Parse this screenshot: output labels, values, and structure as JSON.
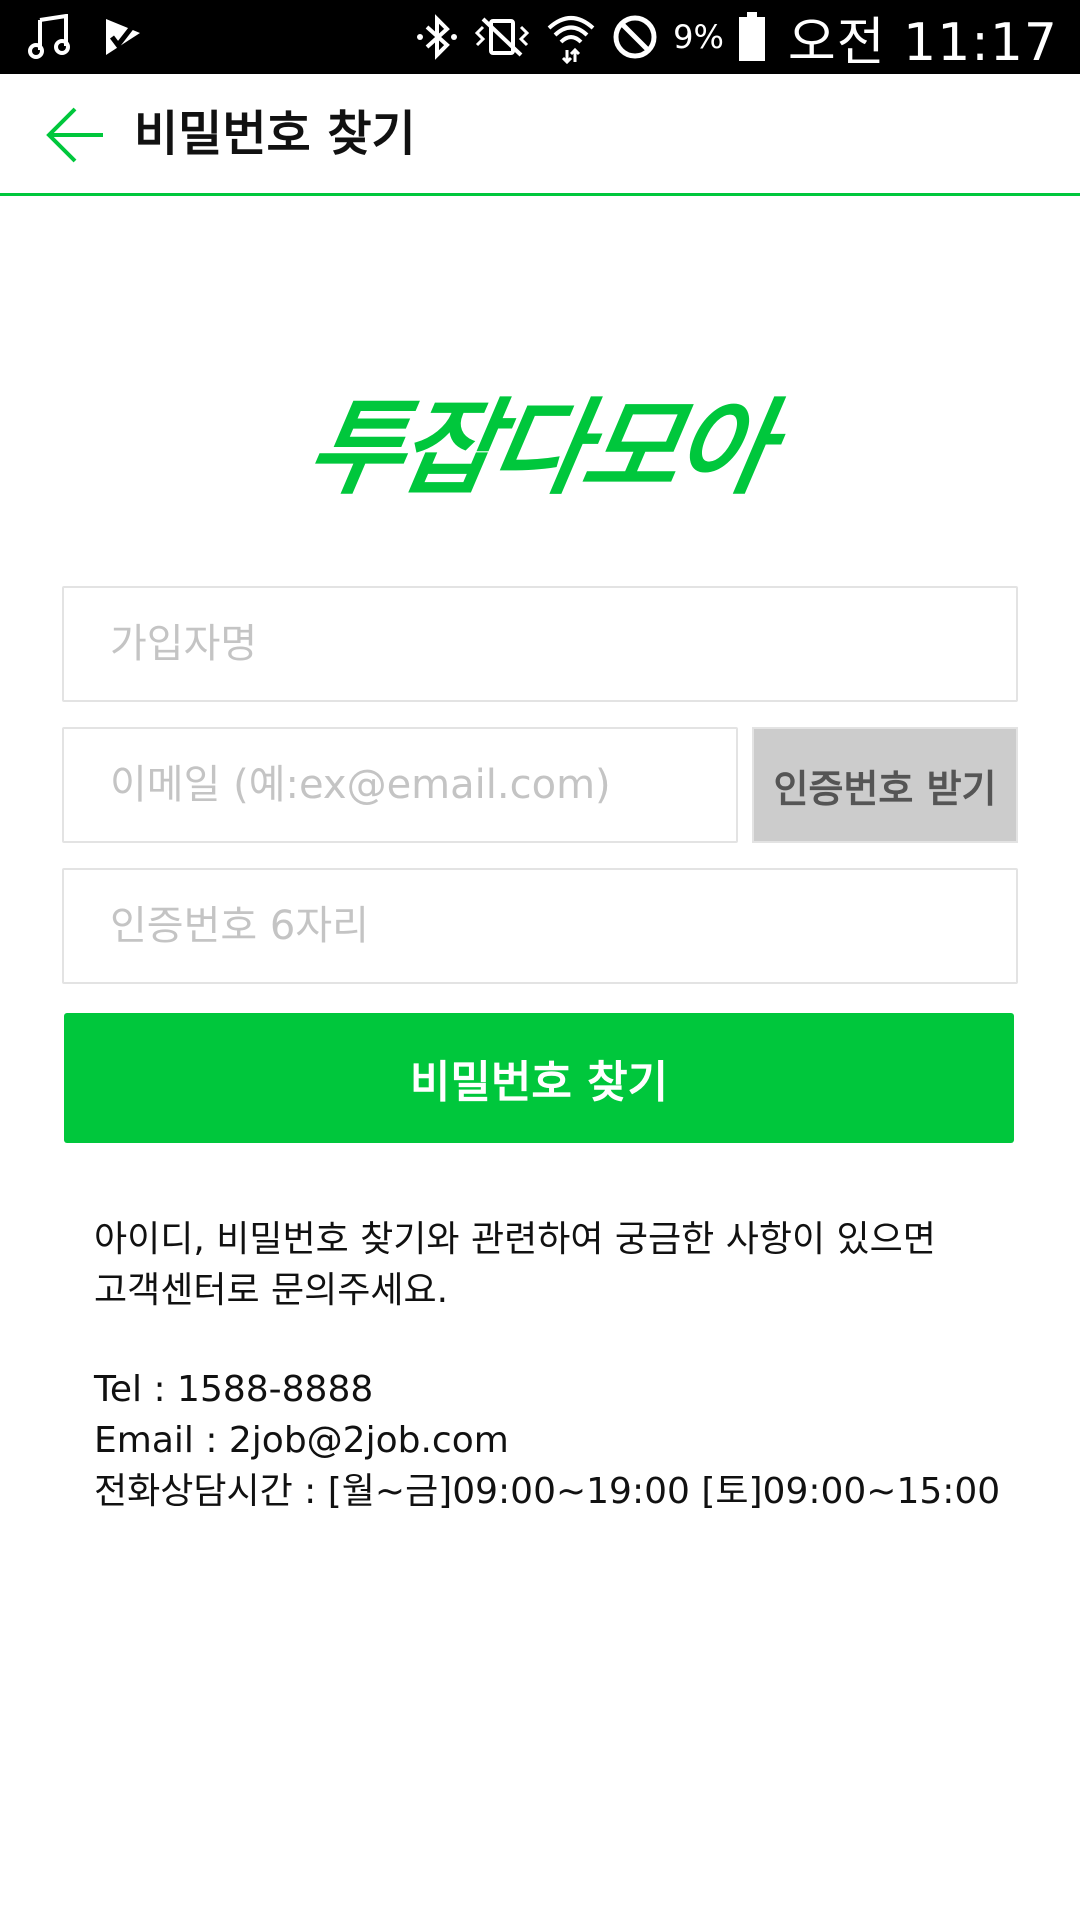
{
  "status_bar": {
    "battery_percent": "9%",
    "time": "오전 11:17",
    "icons_left": [
      "music-icon",
      "check-flag-icon"
    ],
    "icons_right": [
      "bluetooth-icon",
      "vibrate-mute-icon",
      "wifi-icon",
      "do-not-disturb-icon",
      "battery-icon"
    ]
  },
  "header": {
    "title": "비밀번호 찾기",
    "back_icon": "arrow-left-icon",
    "accent_color": "#00c73c"
  },
  "logo": {
    "text": "투잡다모아",
    "color": "#00c73c"
  },
  "form": {
    "name_placeholder": "가입자명",
    "email_placeholder": "이메일 (예:ex@email.com)",
    "verify_button_label": "인증번호 받기",
    "code_placeholder": "인증번호 6자리",
    "submit_label": "비밀번호 찾기"
  },
  "info": {
    "line1": "아이디, 비밀번호 찾기와 관련하여 궁금한 사항이 있으면",
    "line2": "고객센터로 문의주세요.",
    "tel": "Tel : 1588-8888",
    "email": "Email : 2job@2job.com",
    "hours": "전화상담시간 : [월~금]09:00~19:00 [토]09:00~15:00"
  }
}
